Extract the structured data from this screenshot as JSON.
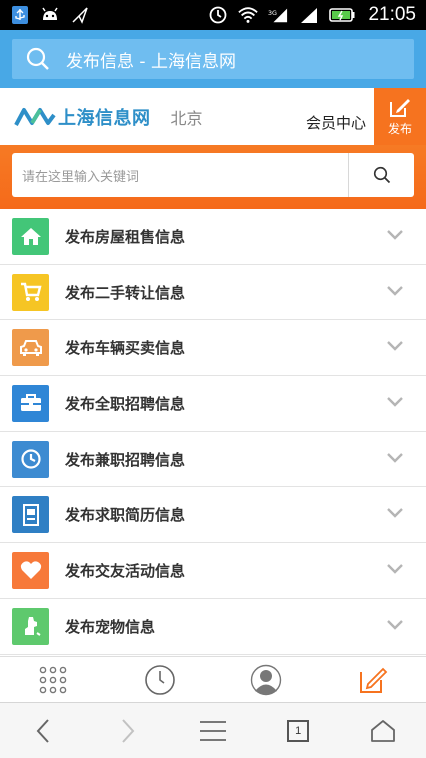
{
  "statusbar": {
    "time": "21:05"
  },
  "browser": {
    "address": "发布信息 - 上海信息网"
  },
  "header": {
    "logo_text": "上海信息网",
    "city": "北京",
    "member_center": "会员中心",
    "publish_label": "发布"
  },
  "search": {
    "placeholder": "请在这里输入关键词"
  },
  "categories": [
    {
      "label": "发布房屋租售信息",
      "icon": "house-icon",
      "color": "#43c678"
    },
    {
      "label": "发布二手转让信息",
      "icon": "cart-icon",
      "color": "#f6c524"
    },
    {
      "label": "发布车辆买卖信息",
      "icon": "car-icon",
      "color": "#ef9a4b"
    },
    {
      "label": "发布全职招聘信息",
      "icon": "briefcase-icon",
      "color": "#2f86d6"
    },
    {
      "label": "发布兼职招聘信息",
      "icon": "clock-icon",
      "color": "#3d8bd1"
    },
    {
      "label": "发布求职简历信息",
      "icon": "resume-icon",
      "color": "#2f7fc4"
    },
    {
      "label": "发布交友活动信息",
      "icon": "heart-icon",
      "color": "#f7793a"
    },
    {
      "label": "发布宠物信息",
      "icon": "pet-icon",
      "color": "#5ec96d"
    }
  ],
  "navbar": {
    "tab_count": "1"
  },
  "colors": {
    "accent": "#f6731f",
    "brand_blue": "#48a8e6"
  }
}
